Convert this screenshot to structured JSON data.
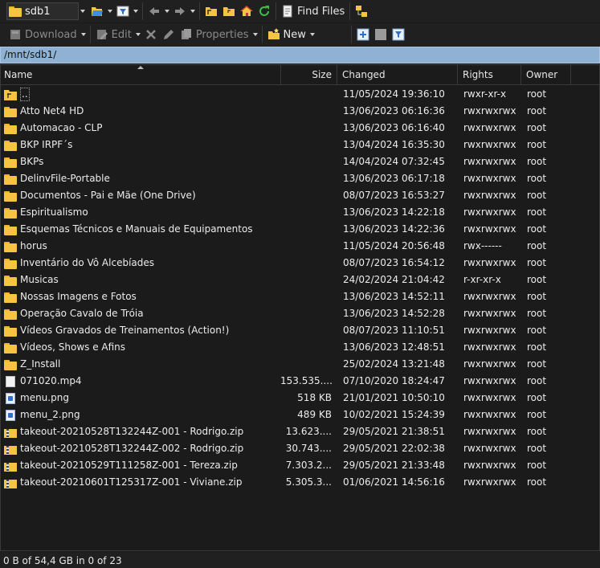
{
  "toolbar1": {
    "drive_label": "sdb1",
    "find_files_label": "Find Files"
  },
  "toolbar2": {
    "download_label": "Download",
    "edit_label": "Edit",
    "properties_label": "Properties",
    "new_label": "New"
  },
  "path": "/mnt/sdb1/",
  "columns": {
    "name": "Name",
    "size": "Size",
    "changed": "Changed",
    "rights": "Rights",
    "owner": "Owner"
  },
  "rows": [
    {
      "type": "updir",
      "name": "..",
      "size": "",
      "changed": "11/05/2024 19:36:10",
      "rights": "rwxr-xr-x",
      "owner": "root"
    },
    {
      "type": "folder",
      "name": "Atto Net4 HD",
      "size": "",
      "changed": "13/06/2023 06:16:36",
      "rights": "rwxrwxrwx",
      "owner": "root"
    },
    {
      "type": "folder",
      "name": "Automacao - CLP",
      "size": "",
      "changed": "13/06/2023 06:16:40",
      "rights": "rwxrwxrwx",
      "owner": "root"
    },
    {
      "type": "folder",
      "name": "BKP IRPF´s",
      "size": "",
      "changed": "13/04/2024 16:35:30",
      "rights": "rwxrwxrwx",
      "owner": "root"
    },
    {
      "type": "folder",
      "name": "BKPs",
      "size": "",
      "changed": "14/04/2024 07:32:45",
      "rights": "rwxrwxrwx",
      "owner": "root"
    },
    {
      "type": "folder",
      "name": "DelinvFile-Portable",
      "size": "",
      "changed": "13/06/2023 06:17:18",
      "rights": "rwxrwxrwx",
      "owner": "root"
    },
    {
      "type": "folder",
      "name": "Documentos - Pai e Mãe (One Drive)",
      "size": "",
      "changed": "08/07/2023 16:53:27",
      "rights": "rwxrwxrwx",
      "owner": "root"
    },
    {
      "type": "folder",
      "name": "Espiritualismo",
      "size": "",
      "changed": "13/06/2023 14:22:18",
      "rights": "rwxrwxrwx",
      "owner": "root"
    },
    {
      "type": "folder",
      "name": "Esquemas Técnicos e Manuais de Equipamentos",
      "size": "",
      "changed": "13/06/2023 14:22:36",
      "rights": "rwxrwxrwx",
      "owner": "root"
    },
    {
      "type": "folder",
      "name": "horus",
      "size": "",
      "changed": "11/05/2024 20:56:48",
      "rights": "rwx------",
      "owner": "root"
    },
    {
      "type": "folder",
      "name": "Inventário do Vô Alcebíades",
      "size": "",
      "changed": "08/07/2023 16:54:12",
      "rights": "rwxrwxrwx",
      "owner": "root"
    },
    {
      "type": "folder",
      "name": "Musicas",
      "size": "",
      "changed": "24/02/2024 21:04:42",
      "rights": "r-xr-xr-x",
      "owner": "root"
    },
    {
      "type": "folder",
      "name": "Nossas Imagens e Fotos",
      "size": "",
      "changed": "13/06/2023 14:52:11",
      "rights": "rwxrwxrwx",
      "owner": "root"
    },
    {
      "type": "folder",
      "name": "Operação Cavalo de Tróia",
      "size": "",
      "changed": "13/06/2023 14:52:28",
      "rights": "rwxrwxrwx",
      "owner": "root"
    },
    {
      "type": "folder",
      "name": "Vídeos Gravados de Treinamentos (Action!)",
      "size": "",
      "changed": "08/07/2023 11:10:51",
      "rights": "rwxrwxrwx",
      "owner": "root"
    },
    {
      "type": "folder",
      "name": "Vídeos, Shows e Afins",
      "size": "",
      "changed": "13/06/2023 12:48:51",
      "rights": "rwxrwxrwx",
      "owner": "root"
    },
    {
      "type": "folder",
      "name": "Z_Install",
      "size": "",
      "changed": "25/02/2024 13:21:48",
      "rights": "rwxrwxrwx",
      "owner": "root"
    },
    {
      "type": "file",
      "name": "071020.mp4",
      "size": "153.535....",
      "changed": "07/10/2020 18:24:47",
      "rights": "rwxrwxrwx",
      "owner": "root"
    },
    {
      "type": "png",
      "name": "menu.png",
      "size": "518 KB",
      "changed": "21/01/2021 10:50:10",
      "rights": "rwxrwxrwx",
      "owner": "root"
    },
    {
      "type": "png",
      "name": "menu_2.png",
      "size": "489 KB",
      "changed": "10/02/2021 15:24:39",
      "rights": "rwxrwxrwx",
      "owner": "root"
    },
    {
      "type": "zip",
      "name": "takeout-20210528T132244Z-001 - Rodrigo.zip",
      "size": "13.623....",
      "changed": "29/05/2021 21:38:51",
      "rights": "rwxrwxrwx",
      "owner": "root"
    },
    {
      "type": "zip",
      "name": "takeout-20210528T132244Z-002 - Rodrigo.zip",
      "size": "30.743....",
      "changed": "29/05/2021 22:02:38",
      "rights": "rwxrwxrwx",
      "owner": "root"
    },
    {
      "type": "zip",
      "name": "takeout-20210529T111258Z-001 - Tereza.zip",
      "size": "7.303.2...",
      "changed": "29/05/2021 21:33:48",
      "rights": "rwxrwxrwx",
      "owner": "root"
    },
    {
      "type": "zip",
      "name": "takeout-20210601T125317Z-001 - Viviane.zip",
      "size": "5.305.3...",
      "changed": "01/06/2021 14:56:16",
      "rights": "rwxrwxrwx",
      "owner": "root"
    }
  ],
  "status": "0 B of 54,4 GB in 0 of 23"
}
